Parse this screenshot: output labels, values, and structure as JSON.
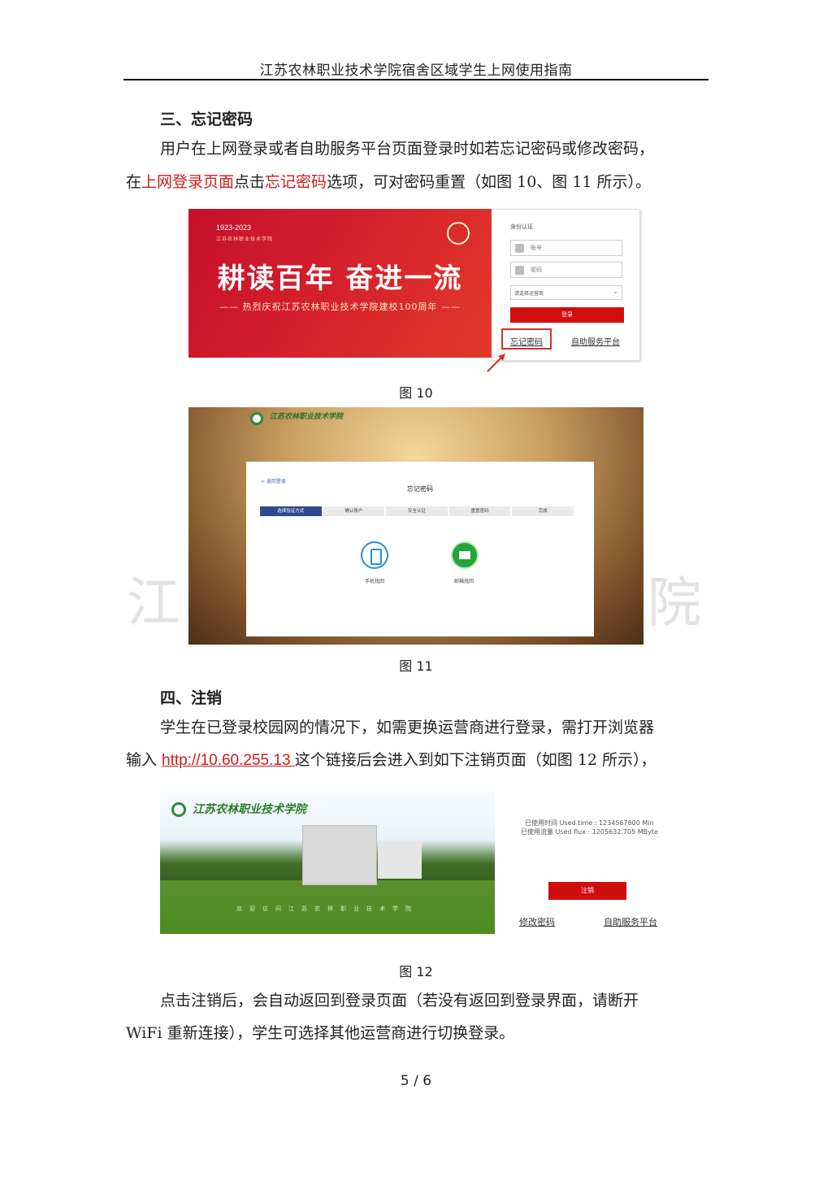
{
  "header": {
    "title": "江苏农林职业技术学院宿舍区域学生上网使用指南"
  },
  "section3": {
    "heading": "三、忘记密码",
    "para_line1": "用户在上网登录或者自助服务平台页面登录时如若忘记密码或修改密码，",
    "para_line2_a": "在",
    "para_line2_red1": "上网登录页面",
    "para_line2_b": "点击",
    "para_line2_red2": "忘记密码",
    "para_line2_c": "选项，可对密码重置（如图 10、图 11 所示）。"
  },
  "fig10": {
    "caption": "图 10",
    "banner_year": "1923-2023",
    "banner_school_small": "江苏农林职业技术学院",
    "banner_slogan": "耕读百年  奋进一流",
    "banner_sub": "—— 热烈庆祝江苏农林职业技术学院建校100周年 ——",
    "login_label": "身份认证",
    "account_placeholder": "账号",
    "password_placeholder": "密码",
    "operator_select": "请选择运营商",
    "login_button": "登录",
    "forgot_link": "忘记密码",
    "selfservice_link": "自助服务平台"
  },
  "fig11": {
    "caption": "图 11",
    "logo_text": "江苏农林职业技术学院",
    "back_link": "< 返回登录",
    "title": "忘记密码",
    "steps": [
      "选择验证方式",
      "确认账户",
      "安全认证",
      "重置密码",
      "完成"
    ],
    "phone_label": "手机找回",
    "email_label": "邮箱找回"
  },
  "section4": {
    "heading": "四、注销",
    "para_line1": "学生在已登录校园网的情况下，如需更换运营商进行登录，需打开浏览器",
    "para_line2_a": "输入 ",
    "para_line2_link": "http://10.60.255.13 ",
    "para_line2_b": "这个链接后会进入到如下注销页面（如图 12 所示），"
  },
  "fig12": {
    "caption": "图 12",
    "logo_text": "江苏农林职业技术学院",
    "welcome_text": "欢迎访问江苏农林职业技术学院",
    "used_time": "已使用时间 Used time : 1234567800 Min",
    "used_flux": "已使用流量 Used flux : 1205632.705 MByte",
    "logout_button": "注销",
    "change_password_link": "修改密码",
    "selfservice_link": "自助服务平台"
  },
  "section_end": {
    "para_line1": "点击注销后，会自动返回到登录页面（若没有返回到登录界面，请断开",
    "para_line2": "WiFi 重新连接），学生可选择其他运营商进行切换登录。"
  },
  "watermark": {
    "left": "江",
    "right": "院"
  },
  "footer": {
    "page": "5 / 6"
  }
}
